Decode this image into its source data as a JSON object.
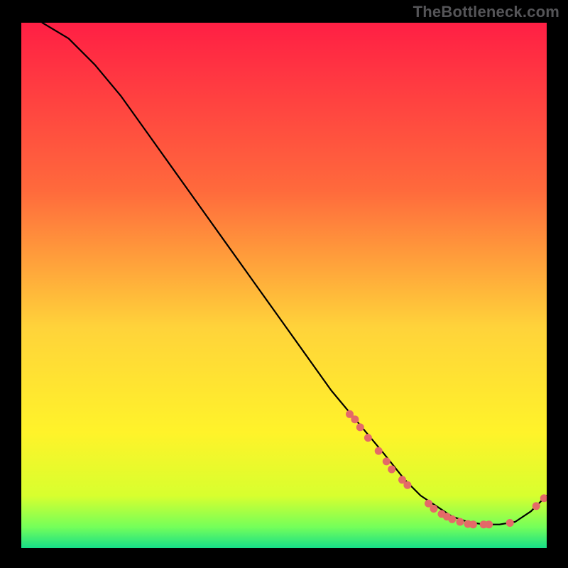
{
  "watermark": "TheBottleneck.com",
  "colors": {
    "grad_top": "#ff1f44",
    "grad_mid_upper": "#ff6a3c",
    "grad_mid": "#ffd33a",
    "grad_mid_lower": "#fff32a",
    "grad_green1": "#d8ff2e",
    "grad_green2": "#74ff5a",
    "grad_green3": "#16de88",
    "curve": "#000000",
    "marker": "#e46a68"
  },
  "chart_data": {
    "type": "line",
    "title": "",
    "xlabel": "",
    "ylabel": "",
    "xlim": [
      0,
      100
    ],
    "ylim": [
      0,
      100
    ],
    "series": [
      {
        "name": "curve",
        "x": [
          4,
          9,
          14,
          19,
          24,
          29,
          34,
          39,
          44,
          49,
          54,
          59,
          64,
          69,
          73,
          76,
          79,
          82,
          85,
          88,
          91,
          94,
          97,
          100
        ],
        "y": [
          100,
          97,
          92,
          86,
          79,
          72,
          65,
          58,
          51,
          44,
          37,
          30,
          24,
          18,
          13,
          10,
          8,
          6,
          5,
          4.5,
          4.5,
          5,
          7,
          10
        ]
      }
    ],
    "markers": [
      {
        "x": 62.5,
        "y": 25.5
      },
      {
        "x": 63.5,
        "y": 24.5
      },
      {
        "x": 64.5,
        "y": 23.0
      },
      {
        "x": 66.0,
        "y": 21.0
      },
      {
        "x": 68.0,
        "y": 18.5
      },
      {
        "x": 69.5,
        "y": 16.5
      },
      {
        "x": 70.5,
        "y": 15.0
      },
      {
        "x": 72.5,
        "y": 13.0
      },
      {
        "x": 73.5,
        "y": 12.0
      },
      {
        "x": 77.5,
        "y": 8.5
      },
      {
        "x": 78.5,
        "y": 7.5
      },
      {
        "x": 80.0,
        "y": 6.5
      },
      {
        "x": 81.0,
        "y": 6.0
      },
      {
        "x": 82.0,
        "y": 5.5
      },
      {
        "x": 83.5,
        "y": 5.0
      },
      {
        "x": 85.0,
        "y": 4.6
      },
      {
        "x": 86.0,
        "y": 4.5
      },
      {
        "x": 88.0,
        "y": 4.5
      },
      {
        "x": 89.0,
        "y": 4.5
      },
      {
        "x": 93.0,
        "y": 4.8
      },
      {
        "x": 98.0,
        "y": 8.0
      },
      {
        "x": 99.5,
        "y": 9.5
      }
    ]
  }
}
